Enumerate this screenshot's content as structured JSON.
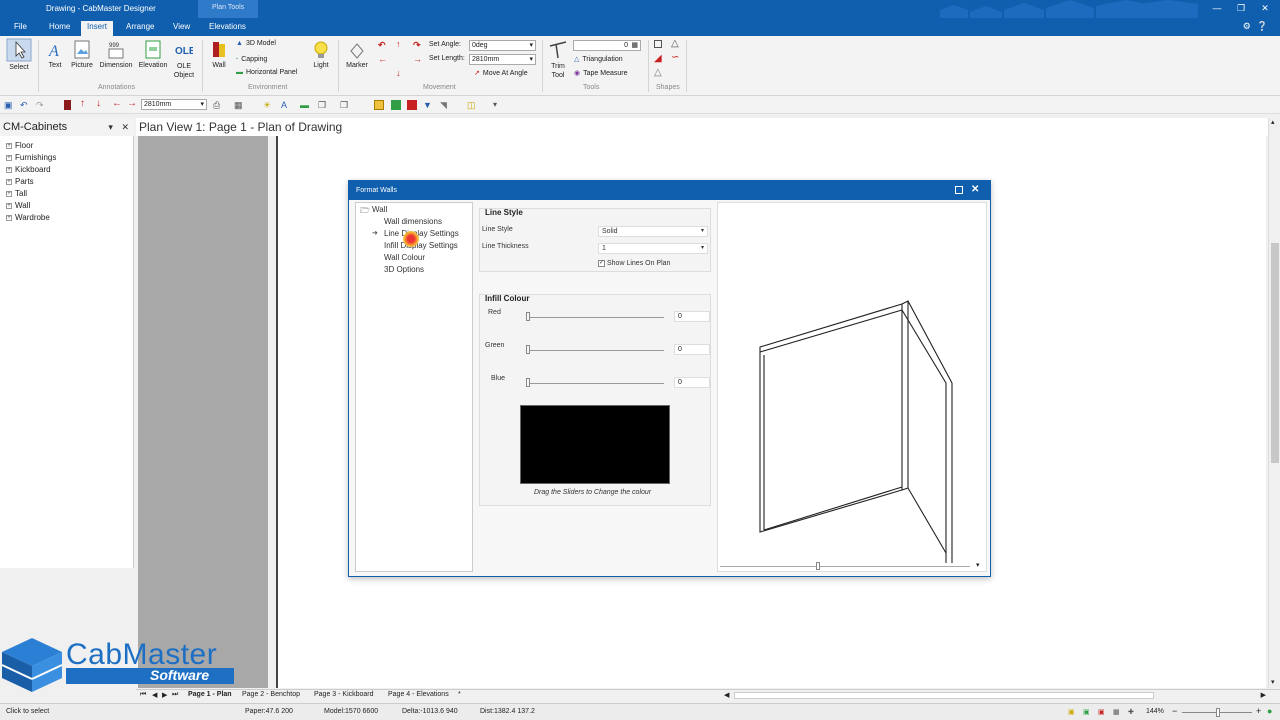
{
  "window": {
    "title": "Drawing - CabMaster Designer",
    "context_tab_group": "Plan Tools"
  },
  "ribbon": {
    "tabs": [
      "File",
      "Home",
      "Insert",
      "Arrange",
      "View",
      "Elevations"
    ],
    "active_tab": "Insert",
    "groups": {
      "select": "Select",
      "annotations": {
        "label": "Annotations",
        "items": [
          "Text",
          "Picture",
          "Dimension",
          "Elevation",
          "OLE Object"
        ]
      },
      "environment": {
        "label": "Environment",
        "wall": "Wall",
        "items": [
          "3D Model",
          "Capping",
          "Horizontal Panel"
        ],
        "light": "Light"
      },
      "movement": {
        "label": "Movement",
        "marker": "Marker",
        "set_angle_label": "Set Angle:",
        "set_angle_value": "0deg",
        "set_length_label": "Set Length:",
        "set_length_value": "2810mm",
        "move_at_angle": "Move At Angle"
      },
      "tools": {
        "label": "Tools",
        "trim_tool": "Trim Tool",
        "field_value": "0",
        "triangulation": "Triangulation",
        "tape_measure": "Tape Measure"
      },
      "shapes": {
        "label": "Shapes"
      }
    }
  },
  "qat": {
    "length_value": "2810mm"
  },
  "left_panel": {
    "title": "CM-Cabinets",
    "items": [
      "Floor",
      "Furnishings",
      "Kickboard",
      "Parts",
      "Tall",
      "Wall",
      "Wardrobe"
    ]
  },
  "plan_view": {
    "title": "Plan View 1: Page 1 - Plan of Drawing"
  },
  "logo": {
    "name": "CabMaster",
    "sub": "Software"
  },
  "page_tabs": [
    "Page 1 - Plan",
    "Page 2 - Benchtop",
    "Page 3 - Kickboard",
    "Page 4 - Elevations"
  ],
  "status": {
    "hint": "Click to select",
    "paper": "Paper:47.6 200",
    "model": "Model:1570 6600",
    "delta": "Delta:-1013.6 940",
    "dist": "Dist:1382.4 137.2",
    "zoom": "144%"
  },
  "dialog": {
    "title": "Format Walls",
    "tree_root": "Wall",
    "tree_items": [
      "Wall dimensions",
      "Line Display Settings",
      "Infill Display Settings",
      "Wall Colour",
      "3D Options"
    ],
    "line_style": {
      "group_title": "Line Style",
      "style_label": "Line Style",
      "style_value": "Solid",
      "thickness_label": "Line Thickness",
      "thickness_value": "1",
      "show_lines_label": "Show Lines On Plan"
    },
    "infill": {
      "group_title": "Infill Colour",
      "red_label": "Red",
      "red_value": "0",
      "green_label": "Green",
      "green_value": "0",
      "blue_label": "Blue",
      "blue_value": "0",
      "swatch_color": "#000000",
      "hint": "Drag the Sliders to Change the colour"
    }
  },
  "colors": {
    "accent": "#0f5fae",
    "brand": "#1d6fc4",
    "arrow": "#c82020"
  }
}
